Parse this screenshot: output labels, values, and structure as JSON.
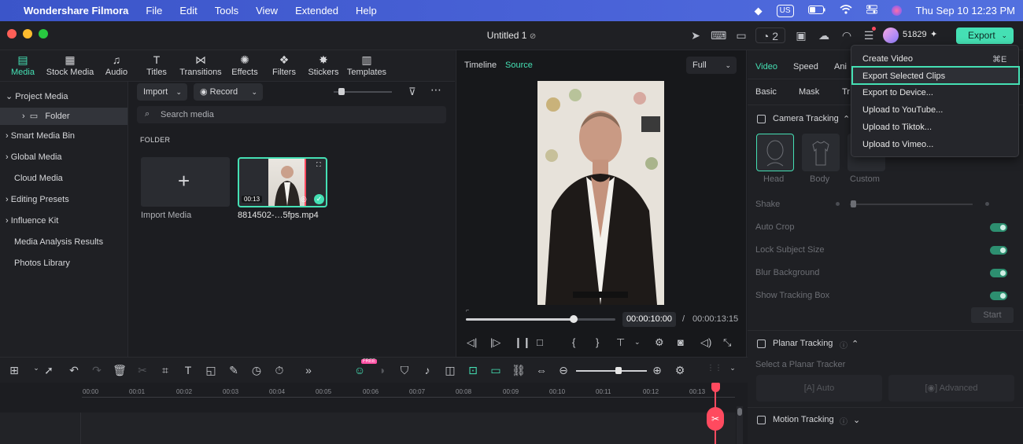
{
  "menubar": {
    "app": "Wondershare Filmora",
    "items": [
      "File",
      "Edit",
      "Tools",
      "View",
      "Extended",
      "Help"
    ],
    "input_source": "US",
    "datetime": "Thu Sep 10  12:23 PM"
  },
  "titlebar": {
    "title": "Untitled 1",
    "notification_count": "2",
    "credits": "51829",
    "export_label": "Export"
  },
  "toptabs": [
    {
      "label": "Media",
      "icon": "media-icon"
    },
    {
      "label": "Stock Media",
      "icon": "stock-media-icon"
    },
    {
      "label": "Audio",
      "icon": "audio-icon"
    },
    {
      "label": "Titles",
      "icon": "titles-icon"
    },
    {
      "label": "Transitions",
      "icon": "transitions-icon"
    },
    {
      "label": "Effects",
      "icon": "effects-icon"
    },
    {
      "label": "Filters",
      "icon": "filters-icon"
    },
    {
      "label": "Stickers",
      "icon": "stickers-icon"
    },
    {
      "label": "Templates",
      "icon": "templates-icon"
    }
  ],
  "sidebar": {
    "items": [
      "Project Media",
      "Folder",
      "Smart Media Bin",
      "Global Media",
      "Cloud Media",
      "Editing Presets",
      "Influence Kit",
      "Media Analysis Results",
      "Photos Library"
    ]
  },
  "media": {
    "import_label": "Import",
    "record_label": "Record",
    "search_placeholder": "Search media",
    "folder_heading": "FOLDER",
    "import_media_label": "Import Media",
    "clip_name": "8814502-…5fps.mp4",
    "clip_duration": "00:13"
  },
  "preview": {
    "tab_timeline": "Timeline",
    "tab_source": "Source",
    "quality": "Full",
    "current_time": "00:00:10:00",
    "separator": "/",
    "total_time": "00:00:13:15",
    "progress_fraction": 0.73
  },
  "rightpanel": {
    "tabs": [
      "Video",
      "Speed",
      "Ani"
    ],
    "subtabs": [
      "Basic",
      "Mask",
      "Tr"
    ],
    "camera_tracking": "Camera Tracking",
    "track_targets": [
      "Head",
      "Body",
      "Custom"
    ],
    "shake": "Shake",
    "auto_crop": "Auto Crop",
    "lock_subject": "Lock Subject Size",
    "blur_background": "Blur Background",
    "show_tracking_box": "Show Tracking Box",
    "start_label": "Start",
    "planar_tracking": "Planar Tracking",
    "select_planar": "Select a Planar Tracker",
    "auto_label": "Auto",
    "advanced_label": "Advanced",
    "motion_tracking": "Motion Tracking"
  },
  "dropdown": {
    "items": [
      "Create Video",
      "Export Selected Clips",
      "Export to Device...",
      "Upload to YouTube...",
      "Upload to Tiktok...",
      "Upload to Vimeo..."
    ],
    "shortcut": "⌘E"
  },
  "timeline": {
    "ticks": [
      "00:00",
      "00:01",
      "00:02",
      "00:03",
      "00:04",
      "00:05",
      "00:06",
      "00:07",
      "00:08",
      "00:09",
      "00:10",
      "00:11",
      "00:12",
      "00:13"
    ],
    "free_badge": "FREE"
  },
  "colors": {
    "accent": "#45e0b4",
    "playhead": "#ff4a5f"
  }
}
